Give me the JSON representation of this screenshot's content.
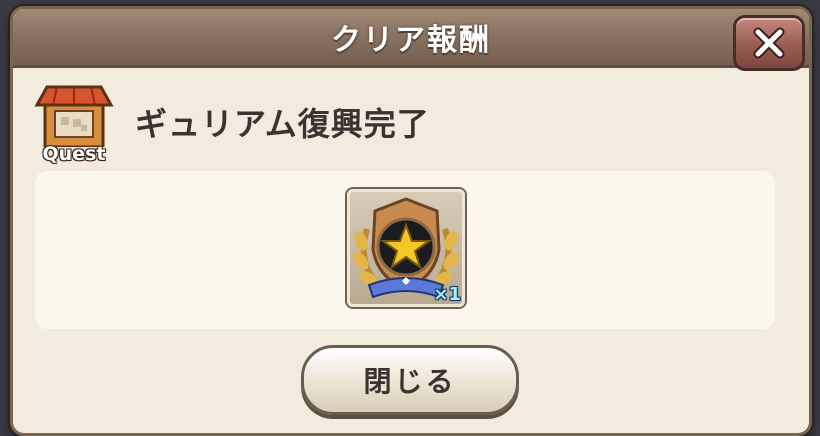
{
  "dialog": {
    "title": "クリア報酬",
    "close_icon": "close-x-icon"
  },
  "quest": {
    "icon": "shop-building-icon",
    "icon_label": "Quest",
    "name": "ギュリアム復興完了"
  },
  "reward": {
    "icon": "star-medal-emblem-icon",
    "quantity": "×1"
  },
  "footer": {
    "close_button_label": "閉じる"
  },
  "colors": {
    "frame": "#7a6550",
    "panel_bg": "#f1ecdd",
    "title_bar": "#85705e",
    "close_button": "#9a5d52",
    "quantity_text": "#9ef0ff"
  }
}
